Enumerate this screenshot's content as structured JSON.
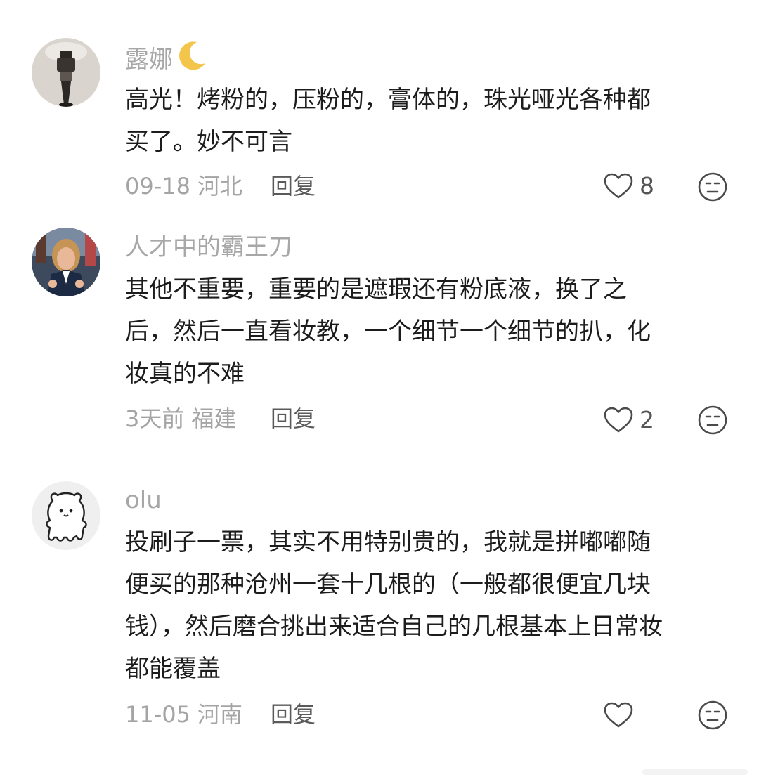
{
  "comments": [
    {
      "username": "露娜",
      "text_lines": [
        "高光！烤粉的，压粉的，膏体的，珠光哑光各种都",
        "买了。妙不可言"
      ],
      "date": "09-18",
      "location": "河北",
      "reply_label": "回复",
      "like_count": "8",
      "avatar_icon": "photo-avatar-icon"
    },
    {
      "username": "人才中的霸王刀",
      "text_lines": [
        "其他不重要，重要的是遮瑕还有粉底液，换了之",
        "后，然后一直看妆教，一个细节一个细节的扒，化",
        "妆真的不难"
      ],
      "date": "3天前",
      "location": "福建",
      "reply_label": "回复",
      "like_count": "2",
      "avatar_icon": "photo-avatar-icon"
    },
    {
      "username": "olu",
      "text_lines": [
        "投刷子一票，其实不用特别贵的，我就是拼嘟嘟随",
        "便买的那种沧州一套十几根的（一般都很便宜几块",
        "钱），然后磨合挑出来适合自己的几根基本上日常妆",
        "都能覆盖"
      ],
      "date": "11-05",
      "location": "河南",
      "reply_label": "回复",
      "like_count": "",
      "avatar_icon": "bear-avatar-icon"
    }
  ],
  "colors": {
    "username": "#a7a7a7",
    "text": "#1c1c1c",
    "meta": "#a4a4a4",
    "reply": "#5a5a5a",
    "icon_stroke": "#4a4a4a",
    "moon": "#f3c64b"
  },
  "icons": {
    "like": "heart-outline-icon",
    "dislike": "neutral-face-icon",
    "username_badge": "crescent-moon-icon"
  }
}
